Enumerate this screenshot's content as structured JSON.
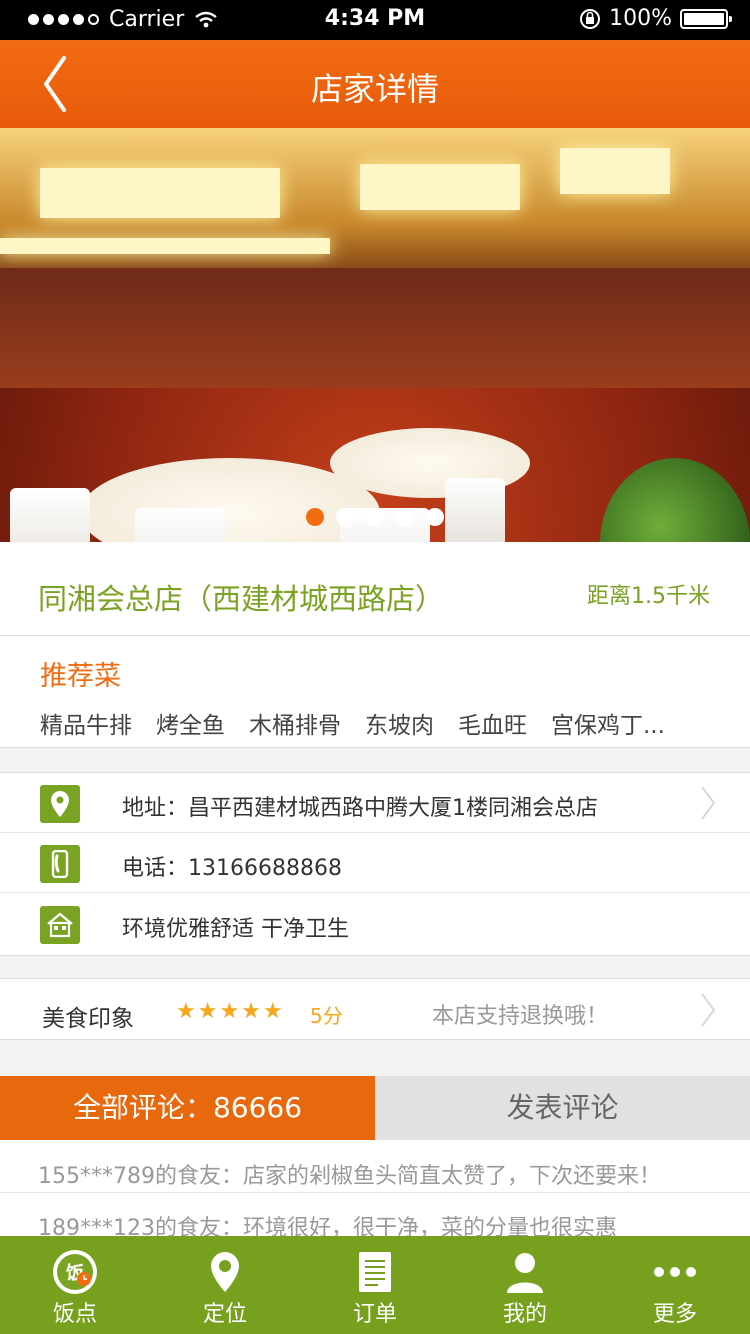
{
  "status_bar": {
    "carrier": "Carrier",
    "time": "4:34 PM",
    "battery": "100%"
  },
  "header": {
    "title": "店家详情"
  },
  "gallery": {
    "page_count": 5,
    "active_index": 0
  },
  "store": {
    "name": "同湘会总店（西建材城西路店）",
    "distance": "距离1.5千米"
  },
  "recommend": {
    "title": "推荐菜",
    "dishes": [
      "精品牛排",
      "烤全鱼",
      "木桶排骨",
      "东坡肉",
      "毛血旺",
      "宫保鸡丁..."
    ]
  },
  "info": {
    "address": "地址：昌平西建材城西路中腾大厦1楼同湘会总店",
    "phone": "电话：13166688868",
    "environment": "环境优雅舒适  干净卫生"
  },
  "rating": {
    "label": "美食印象",
    "stars": "★★★★★",
    "score": "5分",
    "support": "本店支持退换哦！"
  },
  "tabs": {
    "all_reviews": "全部评论：86666",
    "post_review": "发表评论"
  },
  "reviews": [
    "155***789的食友：店家的剁椒鱼头简直太赞了，下次还要来！",
    "189***123的食友：环境很好，很干净，菜的分量也很实惠"
  ],
  "nav": [
    {
      "label": "饭点",
      "icon": "restaurant-icon"
    },
    {
      "label": "定位",
      "icon": "location-icon"
    },
    {
      "label": "订单",
      "icon": "order-icon"
    },
    {
      "label": "我的",
      "icon": "user-icon"
    },
    {
      "label": "更多",
      "icon": "more-icon"
    }
  ],
  "colors": {
    "brand_orange": "#f26c12",
    "brand_green": "#7aa223",
    "star": "#f6a71b"
  }
}
